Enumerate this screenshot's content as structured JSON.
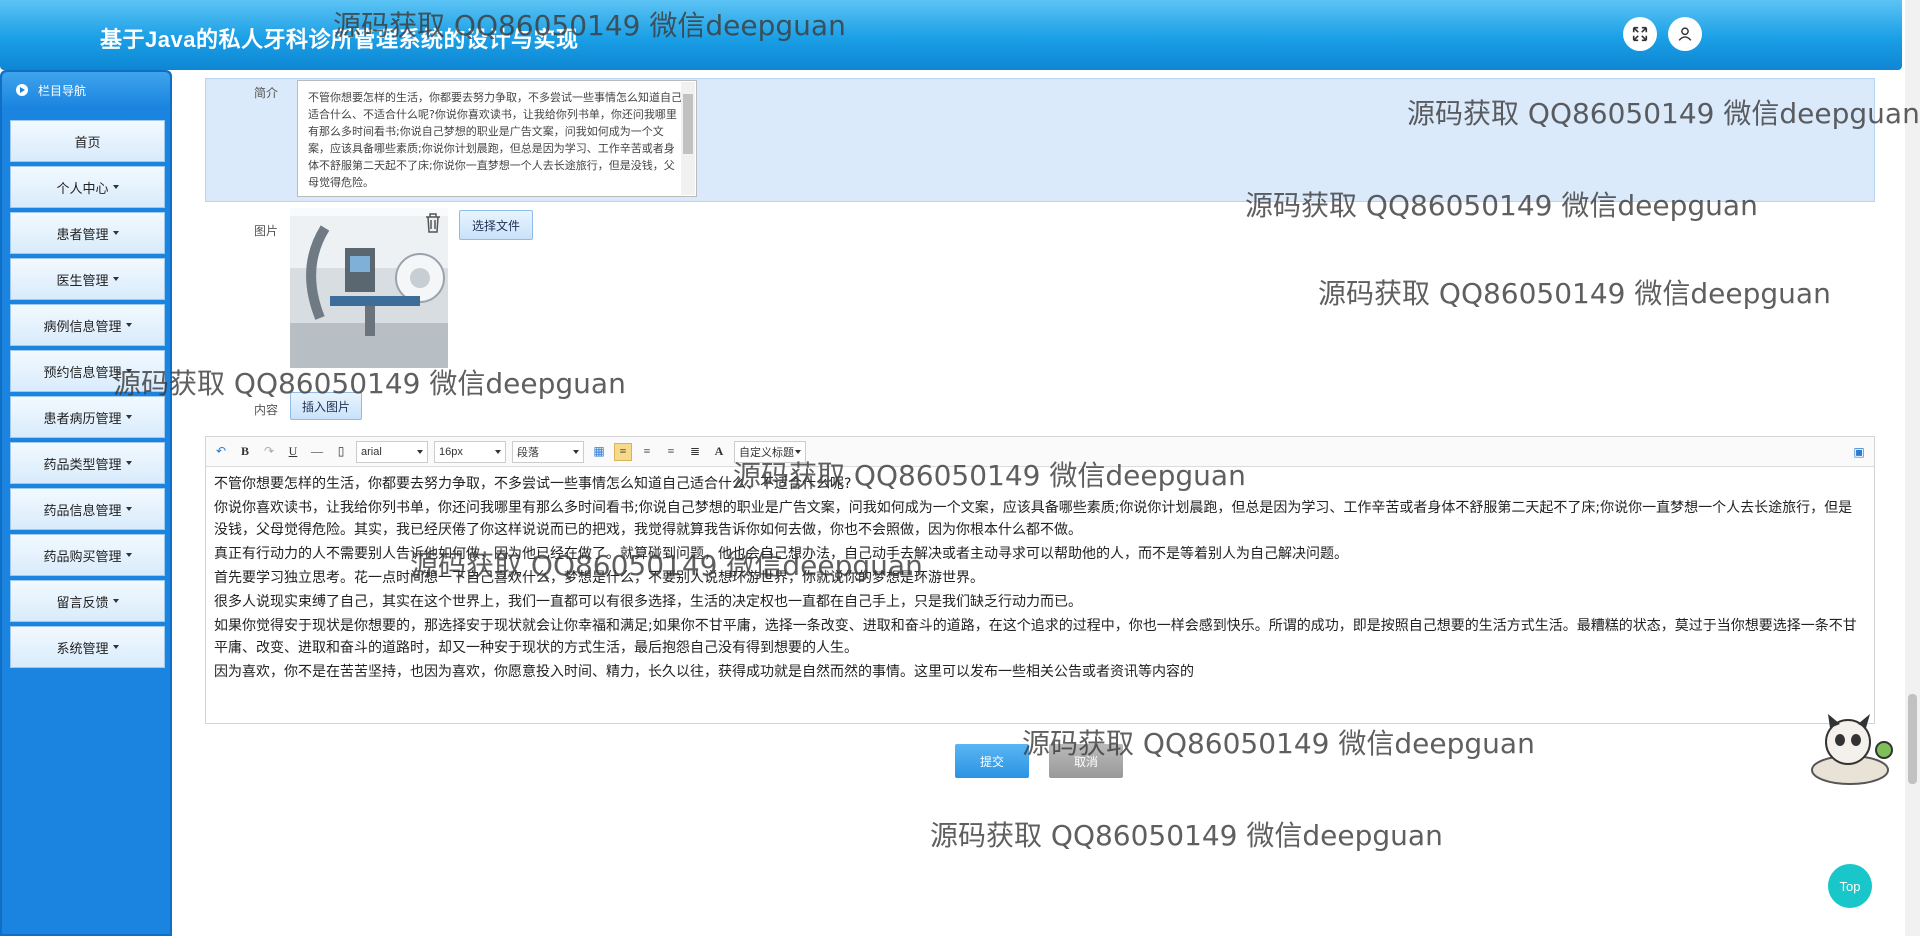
{
  "header": {
    "title": "基于Java的私人牙科诊所管理系统的设计与实现"
  },
  "sidebar": {
    "heading": "栏目导航",
    "items": [
      {
        "label": "首页"
      },
      {
        "label": "个人中心"
      },
      {
        "label": "患者管理"
      },
      {
        "label": "医生管理"
      },
      {
        "label": "病例信息管理"
      },
      {
        "label": "预约信息管理"
      },
      {
        "label": "患者病历管理"
      },
      {
        "label": "药品类型管理"
      },
      {
        "label": "药品信息管理"
      },
      {
        "label": "药品购买管理"
      },
      {
        "label": "留言反馈"
      },
      {
        "label": "系统管理"
      }
    ]
  },
  "form": {
    "intro_label": "简介",
    "intro_text": "不管你想要怎样的生活，你都要去努力争取，不多尝试一些事情怎么知道自己适合什么、不适合什么呢?你说你喜欢读书，让我给你列书单，你还问我哪里有那么多时间看书;你说自己梦想的职业是广告文案，问我如何成为一个文案，应该具备哪些素质;你说你计划晨跑，但总是因为学习、工作辛苦或者身体不舒服第二天起不了床;你说你一直梦想一个人去长途旅行，但是没钱，父母觉得危险。",
    "image_label": "图片",
    "choose_file": "选择文件",
    "content_label": "内容",
    "insert_image": "插入图片"
  },
  "editor": {
    "toolbar": {
      "font": "arial",
      "size": "16px",
      "paragraph": "段落",
      "custom_title": "自定义标题"
    },
    "paragraphs": [
      "不管你想要怎样的生活，你都要去努力争取，不多尝试一些事情怎么知道自己适合什么、不适合什么呢?",
      "你说你喜欢读书，让我给你列书单，你还问我哪里有那么多时间看书;你说自己梦想的职业是广告文案，问我如何成为一个文案，应该具备哪些素质;你说你计划晨跑，但总是因为学习、工作辛苦或者身体不舒服第二天起不了床;你说你一直梦想一个人去长途旅行，但是没钱，父母觉得危险。其实，我已经厌倦了你这样说说而已的把戏，我觉得就算我告诉你如何去做，你也不会照做，因为你根本什么都不做。",
      "真正有行动力的人不需要别人告诉他如何做，因为他已经在做了。就算碰到问题，他也会自己想办法，自己动手去解决或者主动寻求可以帮助他的人，而不是等着别人为自己解决问题。",
      "首先要学习独立思考。花一点时间想一下自己喜欢什么，梦想是什么，不要别人说想环游世界，你就说你的梦想是环游世界。",
      "很多人说现实束缚了自己，其实在这个世界上，我们一直都可以有很多选择，生活的决定权也一直都在自己手上，只是我们缺乏行动力而已。",
      "如果你觉得安于现状是你想要的，那选择安于现状就会让你幸福和满足;如果你不甘平庸，选择一条改变、进取和奋斗的道路，在这个追求的过程中，你也一样会感到快乐。所谓的成功，即是按照自己想要的生活方式生活。最糟糕的状态，莫过于当你想要选择一条不甘平庸、改变、进取和奋斗的道路时，却又一种安于现状的方式生活，最后抱怨自己没有得到想要的人生。",
      "因为喜欢，你不是在苦苦坚持，也因为喜欢，你愿意投入时间、精力，长久以往，获得成功就是自然而然的事情。这里可以发布一些相关公告或者资讯等内容的"
    ]
  },
  "actions": {
    "submit": "提交",
    "cancel": "取消"
  },
  "top_button": "Top",
  "watermark": "源码获取 QQ86050149 微信deepguan"
}
